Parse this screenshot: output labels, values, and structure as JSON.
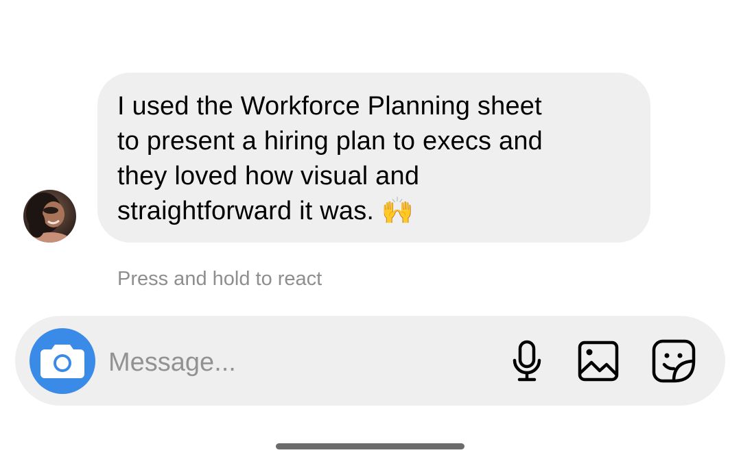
{
  "conversation": {
    "message": {
      "lines": [
        "I used the Workforce Planning sheet",
        "to present a hiring plan to execs and",
        "they loved how visual and",
        "straightforward it was. 🙌"
      ]
    },
    "reaction_hint": "Press and hold to react"
  },
  "composer": {
    "placeholder": "Message...",
    "icons": {
      "camera": "camera-icon",
      "mic": "microphone-icon",
      "gallery": "image-gallery-icon",
      "sticker": "sticker-icon"
    },
    "accent_color": "#3a8be8"
  },
  "colors": {
    "bubble_background": "#efefef",
    "hint_text": "#8e8e8e",
    "placeholder_text": "#929292"
  }
}
